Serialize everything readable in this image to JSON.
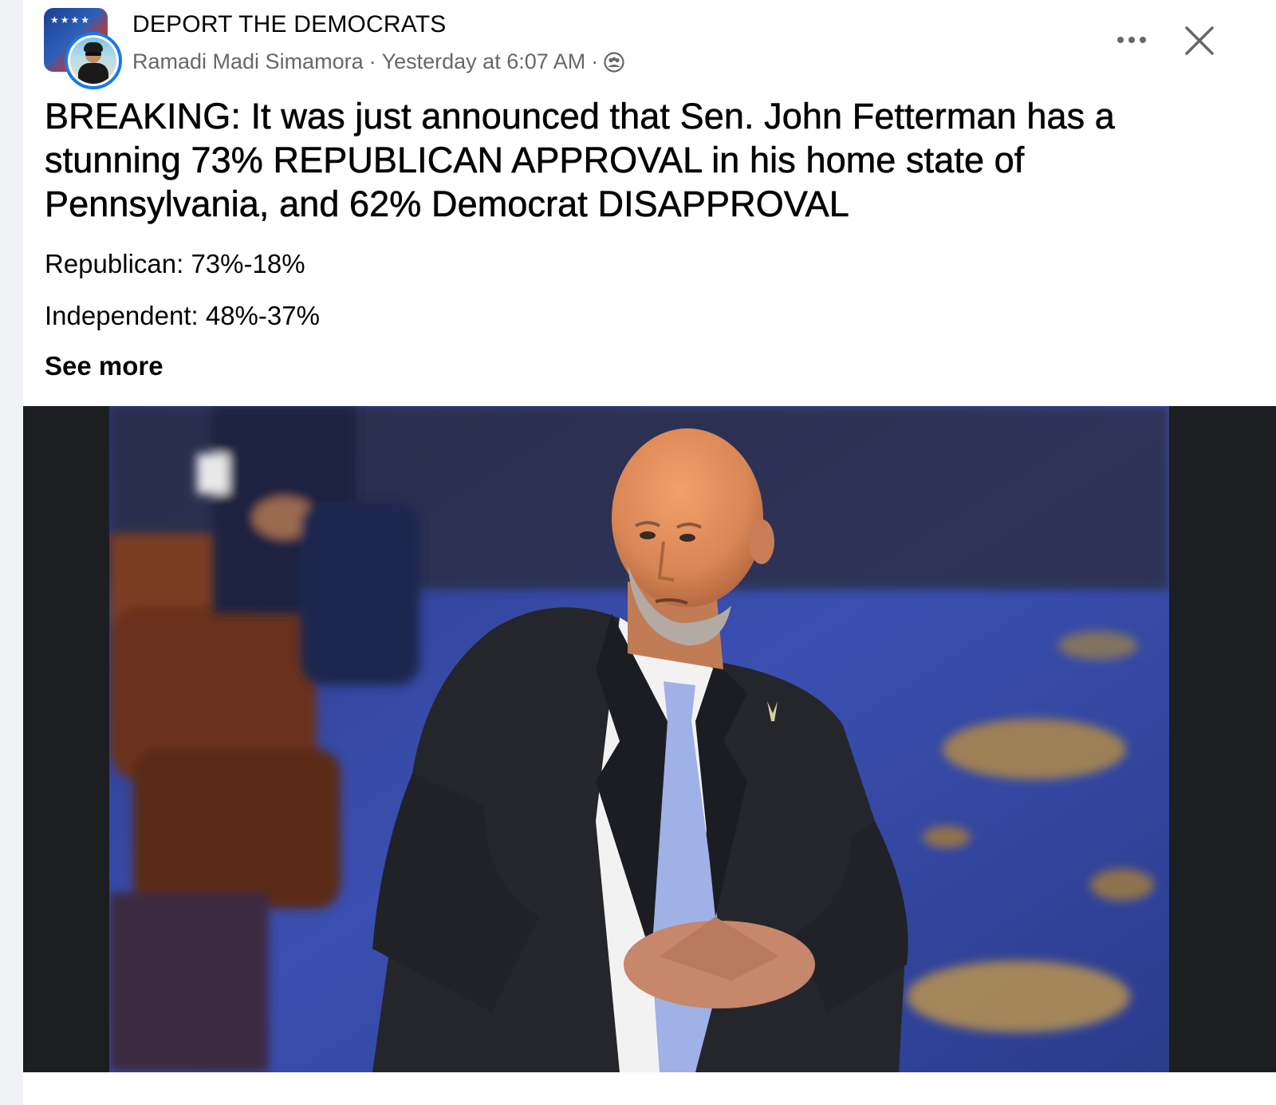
{
  "post": {
    "group_name": "DEPORT THE DEMOCRATS",
    "author": "Ramadi Madi Simamora",
    "separator": "·",
    "timestamp": "Yesterday at 6:07 AM",
    "privacy": "group-members-icon",
    "headline": "BREAKING: It was just announced that Sen. John Fetterman has a stunning 73% REPUBLICAN APPROVAL in his home state of Pennsylvania, and 62% Democrat DISAPPROVAL",
    "stats": [
      "Republican: 73%-18%",
      "Independent: 48%-37%"
    ],
    "see_more": "See more",
    "photo_alt": "Photo of a bald man in a dark suit and light blue tie standing with hands clasped on a blue patterned carpet"
  },
  "controls": {
    "more_icon": "more-options-icon",
    "close_icon": "close-icon"
  },
  "colors": {
    "text_primary": "#050505",
    "text_secondary": "#65676b",
    "accent": "#1877f2",
    "media_bg": "#1c1e21"
  }
}
